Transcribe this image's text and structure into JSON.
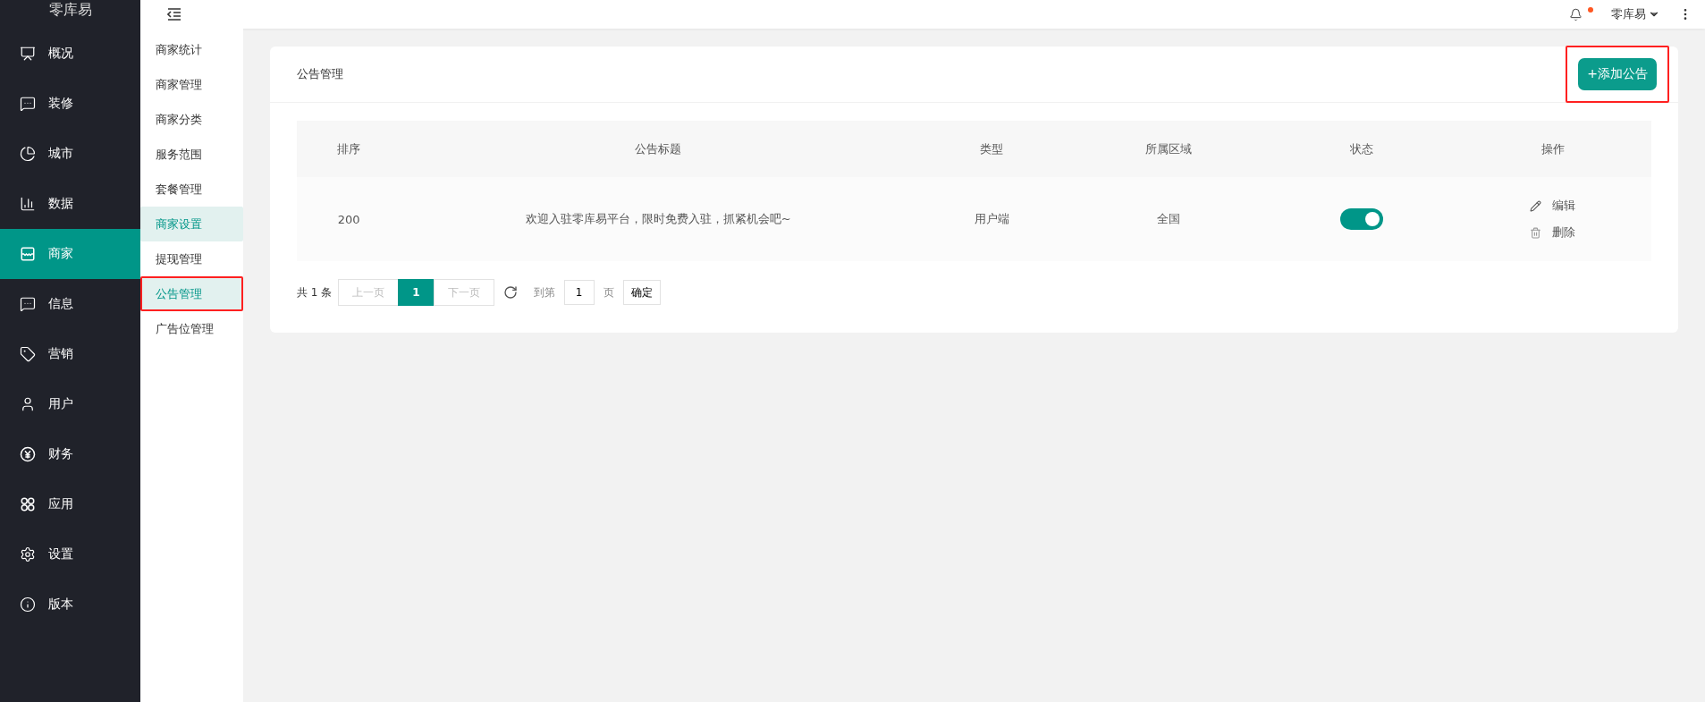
{
  "brand": "零库易",
  "sidebar": {
    "items": [
      {
        "label": "概况",
        "selected": false
      },
      {
        "label": "装修",
        "selected": false
      },
      {
        "label": "城市",
        "selected": false
      },
      {
        "label": "数据",
        "selected": false
      },
      {
        "label": "商家",
        "selected": true
      },
      {
        "label": "信息",
        "selected": false
      },
      {
        "label": "营销",
        "selected": false
      },
      {
        "label": "用户",
        "selected": false
      },
      {
        "label": "财务",
        "selected": false
      },
      {
        "label": "应用",
        "selected": false
      },
      {
        "label": "设置",
        "selected": false
      },
      {
        "label": "版本",
        "selected": false
      }
    ]
  },
  "submenu": {
    "items": [
      {
        "label": "商家统计",
        "selected": false,
        "highlighted": false
      },
      {
        "label": "商家管理",
        "selected": false,
        "highlighted": false
      },
      {
        "label": "商家分类",
        "selected": false,
        "highlighted": false
      },
      {
        "label": "服务范围",
        "selected": false,
        "highlighted": false
      },
      {
        "label": "套餐管理",
        "selected": false,
        "highlighted": false
      },
      {
        "label": "商家设置",
        "selected": true,
        "highlighted": false
      },
      {
        "label": "提现管理",
        "selected": false,
        "highlighted": false
      },
      {
        "label": "公告管理",
        "selected": true,
        "highlighted": true
      },
      {
        "label": "广告位管理",
        "selected": false,
        "highlighted": false
      }
    ]
  },
  "header": {
    "user": "零库易",
    "has_notification": true
  },
  "card": {
    "title": "公告管理",
    "add_button": {
      "label": "+添加公告",
      "highlighted": true
    }
  },
  "table": {
    "columns": [
      "排序",
      "公告标题",
      "类型",
      "所属区域",
      "状态",
      "操作"
    ],
    "rows": [
      {
        "order": "200",
        "title": "欢迎入驻零库易平台，限时免费入驻，抓紧机会吧~",
        "type": "用户端",
        "region": "全国",
        "status_on": true,
        "actions": [
          "编辑",
          "删除"
        ]
      }
    ]
  },
  "pagination": {
    "total": "共 1 条",
    "prev": "上一页",
    "pages": [
      {
        "label": "1",
        "selected": true
      }
    ],
    "next": "下一页",
    "goto_label": "到第",
    "goto_value": "1",
    "page_suffix": "页",
    "confirm": "确定"
  }
}
